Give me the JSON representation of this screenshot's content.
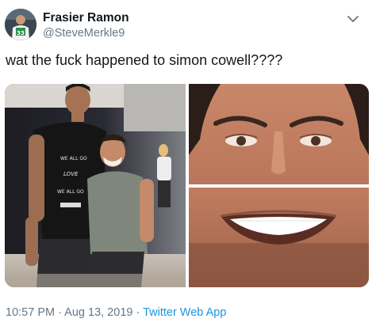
{
  "author": {
    "display_name": "Frasier Ramon",
    "handle": "@SteveMerkle9",
    "avatar_icon": "avatar-photo"
  },
  "menu": {
    "icon": "chevron-down-icon"
  },
  "tweet": {
    "text": "wat the fuck happened to simon cowell????"
  },
  "media": {
    "photo_1": {
      "kind": "photo",
      "shirt_text": [
        "WE ALL GO",
        "LOVE",
        "WE ALL GO"
      ]
    },
    "photo_2": {
      "kind": "photo"
    },
    "photo_3": {
      "kind": "photo"
    }
  },
  "meta": {
    "time": "10:57 PM",
    "separator": " · ",
    "date": "Aug 13, 2019",
    "app": "Twitter Web App"
  },
  "colors": {
    "text_primary": "#14171a",
    "text_secondary": "#657786",
    "link": "#1b95e0"
  }
}
